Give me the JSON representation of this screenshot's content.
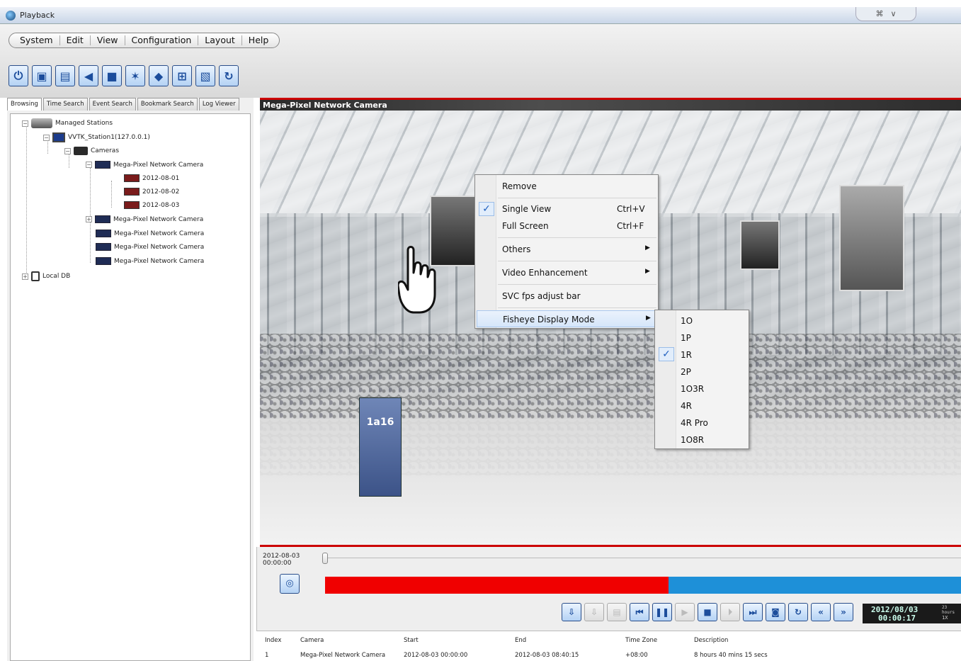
{
  "window": {
    "title": "Playback",
    "controls": [
      "⌘",
      "∨"
    ]
  },
  "menu": [
    "System",
    "Edit",
    "View",
    "Configuration",
    "Layout",
    "Help"
  ],
  "toolbar": [
    {
      "name": "power-icon",
      "glyph": "⏻"
    },
    {
      "name": "network-icon",
      "glyph": "▣"
    },
    {
      "name": "lock-icon",
      "glyph": "▤"
    },
    {
      "name": "speaker-icon",
      "glyph": "◀"
    },
    {
      "name": "snapshot-icon",
      "glyph": "■"
    },
    {
      "name": "ptz-icon",
      "glyph": "✶"
    },
    {
      "name": "record-icon",
      "glyph": "◆"
    },
    {
      "name": "layout-grid-icon",
      "glyph": "⊞"
    },
    {
      "name": "fullscreen-icon",
      "glyph": "▧"
    },
    {
      "name": "refresh-icon",
      "glyph": "↻"
    }
  ],
  "tabs": [
    "Browsing",
    "Time Search",
    "Event Search",
    "Bookmark Search",
    "Log Viewer"
  ],
  "tree": {
    "root": "Managed Stations",
    "station": "VVTK_Station1(127.0.0.1)",
    "cameras_folder": "Cameras",
    "camera": "Mega-Pixel Network Camera",
    "dates": [
      "2012-08-01",
      "2012-08-02",
      "2012-08-03"
    ],
    "other_cameras": [
      "Mega-Pixel Network Camera",
      "Mega-Pixel Network Camera",
      "Mega-Pixel Network Camera",
      "Mega-Pixel Network Camera"
    ],
    "local_db": "Local DB"
  },
  "video": {
    "title": "Mega-Pixel Network Camera",
    "sign_text": "1a16"
  },
  "context_menu": {
    "remove": "Remove",
    "single_view": "Single View",
    "single_view_shortcut": "Ctrl+V",
    "full_screen": "Full Screen",
    "full_screen_shortcut": "Ctrl+F",
    "others": "Others",
    "video_enhancement": "Video Enhancement",
    "svc_fps": "SVC fps adjust bar",
    "fisheye": "Fisheye Display Mode"
  },
  "fisheye_modes": [
    "1O",
    "1P",
    "1R",
    "2P",
    "1O3R",
    "4R",
    "4R Pro",
    "1O8R"
  ],
  "fisheye_selected": "1R",
  "playback": {
    "start_date": "2012-08-03",
    "start_time": "00:00:00",
    "clock_date": "2012/08/03",
    "clock_time": "00:00:17",
    "clock_tz": "23 hours",
    "clock_speed": "1X",
    "progress_recorded_fraction": 0.54
  },
  "table": {
    "headers": [
      "Index",
      "Camera",
      "Start",
      "End",
      "Time Zone",
      "Description"
    ],
    "rows": [
      [
        "1",
        "Mega-Pixel Network Camera",
        "2012-08-03 00:00:00",
        "2012-08-03 08:40:15",
        "+08:00",
        "8 hours 40 mins 15 secs"
      ]
    ]
  },
  "colors": {
    "accent": "#c00000",
    "recorded": "#f00000",
    "timeline": "#1e90d8",
    "button": "#1c4d9c"
  }
}
